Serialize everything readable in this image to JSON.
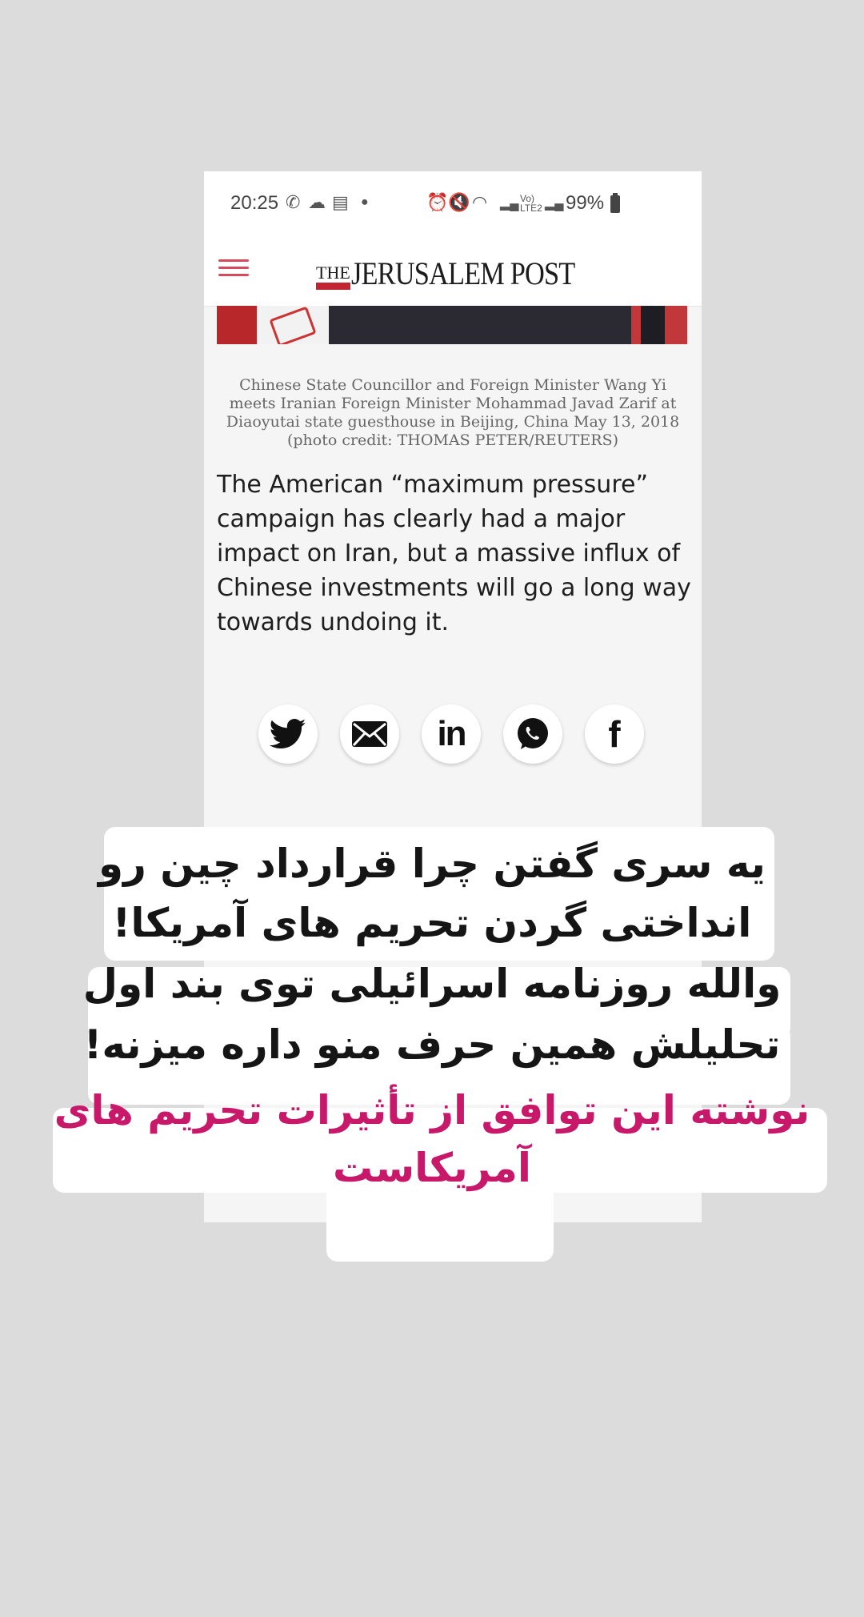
{
  "status_bar": {
    "time": "20:25",
    "battery": "99%",
    "icons": [
      "whatsapp-icon",
      "cloud-icon",
      "calendar-icon",
      "dot-icon",
      "alarm-icon",
      "mute-icon",
      "wifi-icon",
      "signal-icon",
      "volte-icon",
      "battery-icon"
    ]
  },
  "header": {
    "logo_the": "THE",
    "logo_main": "JERUSALEM POST"
  },
  "article": {
    "caption": "Chinese State Councillor and Foreign Minister Wang Yi meets Iranian Foreign Minister Mohammad Javad Zarif at Diaoyutai state guesthouse in Beijing, China May 13, 2018 (photo credit: THOMAS PETER/REUTERS)",
    "lead": "The American “maximum pressure” campaign has clearly had a major impact on Iran, but a massive influx of Chinese investments will go a long way towards undoing it."
  },
  "share": {
    "buttons": [
      "twitter-icon",
      "email-icon",
      "linkedin-icon",
      "whatsapp-icon",
      "facebook-icon"
    ],
    "linkedin_label": "in",
    "facebook_label": "f"
  },
  "overlay": {
    "line_1": "یه سری گفتن چرا قرارداد چین رو",
    "line_2": "انداختی گردن تحریم های آمریکا!",
    "line_3": "والله روزنامه اسرائیلی توی بند اول",
    "line_4": "تحلیلش همین حرف منو داره میزنه!",
    "pink_line_1": "نوشته این توافق از تأثیرات تحریم های",
    "pink_line_2": "آمریکاست",
    "colors": {
      "text": "#151515",
      "highlight": "#c8186a"
    }
  }
}
